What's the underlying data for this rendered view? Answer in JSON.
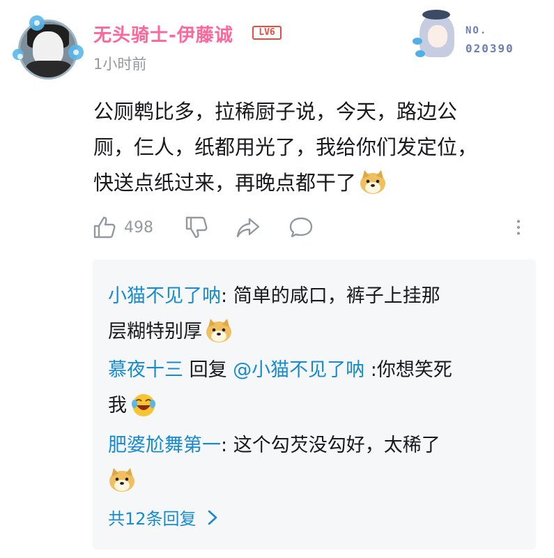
{
  "comment": {
    "user_name": "无头骑士-伊藤诚",
    "level": "LV6",
    "timestamp": "1小时前",
    "fan_card": {
      "label": "NO.",
      "number": "020390"
    },
    "body_line1": "公厕鹎比多，拉稀厨子说，今天，路边公",
    "body_line2": "厕，仨人，纸都用光了，我给你们发定位，",
    "body_line3": "快送点纸过来，再晚点都干了",
    "body_emoji": "doge-emoji",
    "like_count": "498"
  },
  "actions": {
    "like_icon": "thumbs-up-icon",
    "dislike_icon": "thumbs-down-icon",
    "share_icon": "share-icon",
    "reply_icon": "comment-bubble-icon",
    "more_icon": "more-vertical-icon"
  },
  "replies": [
    {
      "user": "小猫不见了呐",
      "sep": ":",
      "text_line1": " 简单的咸口，裤子上挂那",
      "text_line2": "层糊特别厚",
      "emoji": "doge-emoji"
    },
    {
      "user": "慕夜十三",
      "reply_word": " 回复 ",
      "mention": "@小猫不见了呐",
      "text_line1": " :你想笑死",
      "text_line2": "我",
      "emoji": "laugh-cry-emoji"
    },
    {
      "user": "肥婆尬舞第一",
      "sep": ":",
      "text_line1": " 这个勾芡没勾好，太稀了",
      "emoji": "doge-emoji"
    }
  ],
  "more_replies_label": "共12条回复",
  "colors": {
    "username_pink": "#ff6699",
    "link_blue": "#178bcf",
    "level_red": "#e84c3d",
    "meta_gray": "#9499a0",
    "reply_bg": "#f6f7f8"
  }
}
